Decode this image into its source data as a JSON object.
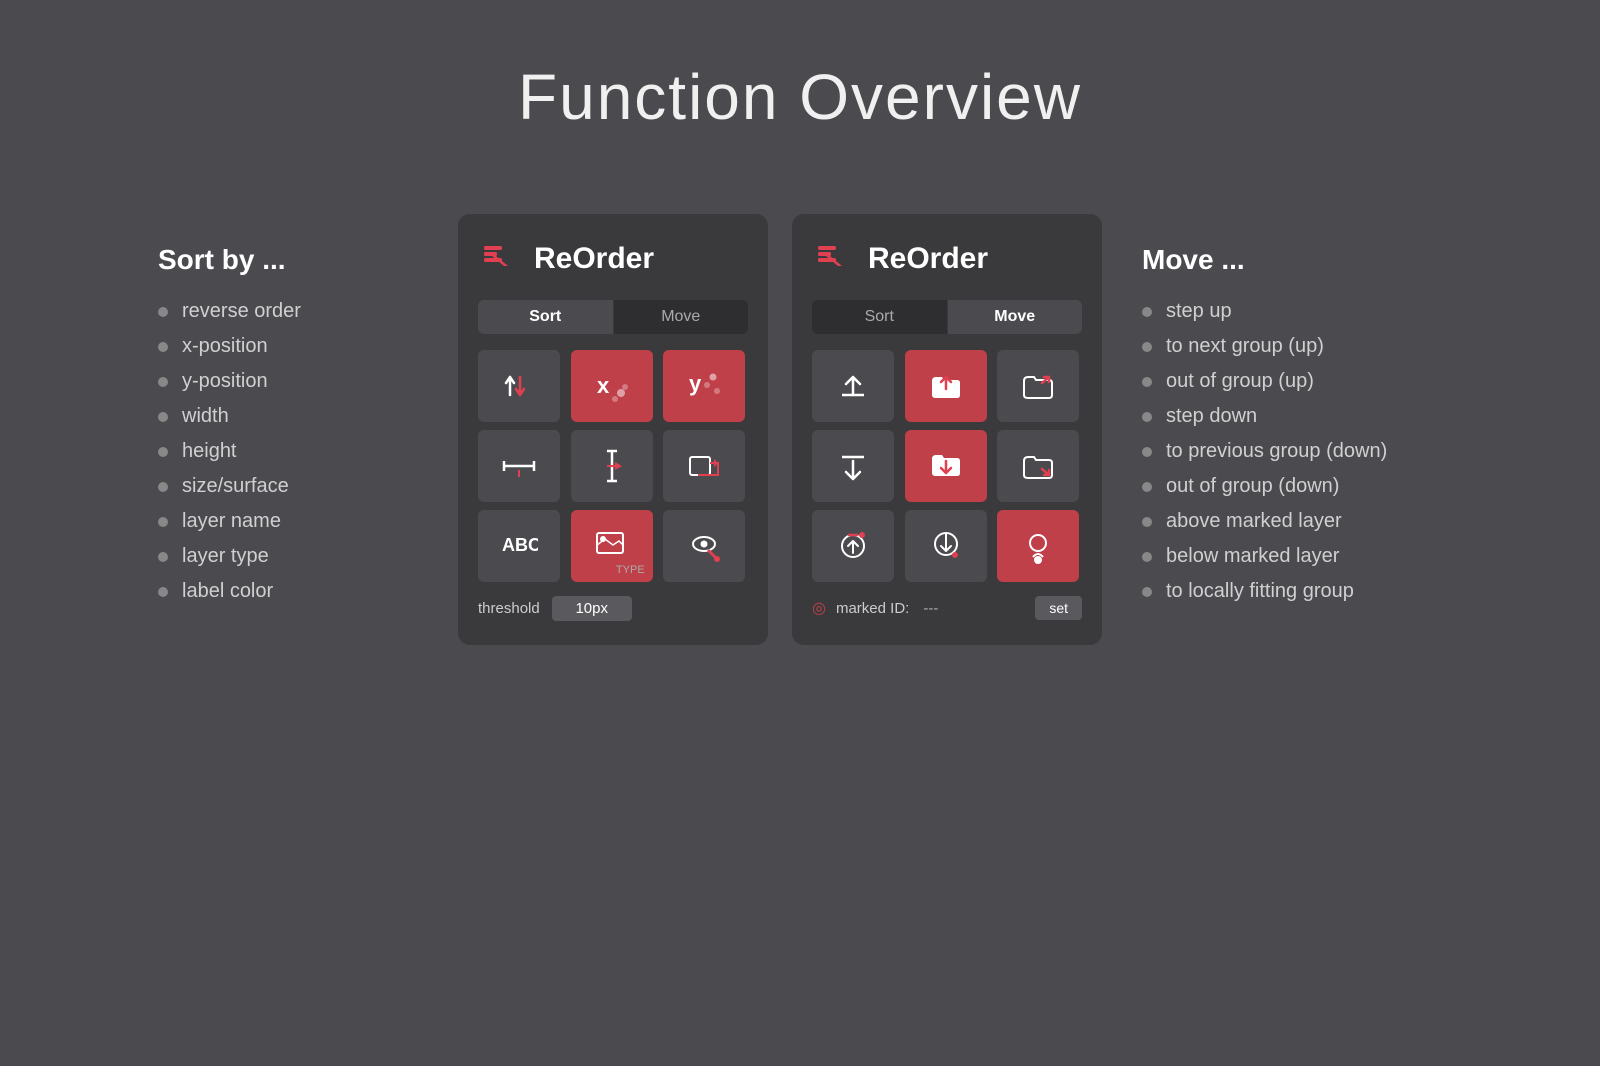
{
  "page": {
    "title": "Function Overview",
    "background": "#4a4a4f"
  },
  "left_panel": {
    "title": "Sort by ...",
    "items": [
      "reverse order",
      "x-position",
      "y-position",
      "width",
      "height",
      "size/surface",
      "layer name",
      "layer type",
      "label color"
    ]
  },
  "right_panel": {
    "title": "Move ...",
    "items": [
      "step up",
      "to next group (up)",
      "out of group (up)",
      "step down",
      "to previous group (down)",
      "out of group (down)",
      "above marked layer",
      "below marked layer",
      "to locally fitting group"
    ]
  },
  "sort_panel": {
    "plugin_name": "ReOrder",
    "tabs": [
      "Sort",
      "Move"
    ],
    "active_tab": "Sort",
    "threshold_label": "threshold",
    "threshold_value": "10px"
  },
  "move_panel": {
    "plugin_name": "ReOrder",
    "tabs": [
      "Sort",
      "Move"
    ],
    "active_tab": "Move",
    "marked_label": "marked ID:",
    "marked_value": "---",
    "set_label": "set"
  }
}
